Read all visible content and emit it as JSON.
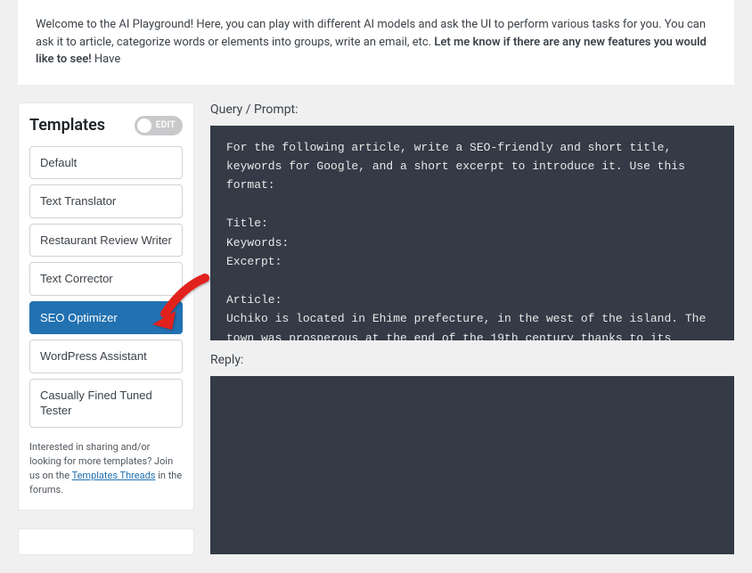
{
  "welcome": {
    "text_before": "Welcome to the AI Playground! Here, you can play with different AI models and ask the UI to perform various tasks for you. You can ask it to article, categorize words or elements into groups, write an email, etc. ",
    "text_bold": "Let me know if there are any new features you would like to see!",
    "text_after": " Have"
  },
  "sidebar": {
    "title": "Templates",
    "edit_label": "EDIT",
    "items": [
      {
        "label": "Default",
        "active": false
      },
      {
        "label": "Text Translator",
        "active": false
      },
      {
        "label": "Restaurant Review Writer",
        "active": false
      },
      {
        "label": "Text Corrector",
        "active": false
      },
      {
        "label": "SEO Optimizer",
        "active": true
      },
      {
        "label": "WordPress Assistant",
        "active": false
      },
      {
        "label": "Casually Fined Tuned Tester",
        "active": false
      }
    ],
    "note_before": "Interested in sharing and/or looking for more templates? Join us on the ",
    "note_link": "Templates Threads",
    "note_after": " in the forums."
  },
  "main": {
    "query_label": "Query / Prompt:",
    "prompt_text": "For the following article, write a SEO-friendly and short title, keywords for Google, and a short excerpt to introduce it. Use this format:\n\nTitle:\nKeywords:\nExcerpt:\n\nArticle:\nUchiko is located in Ehime prefecture, in the west of the island. The town was prosperous at the end of the 19th century thanks to its production of very good quality white wax. This economic boom allowed wealthy local merchants to build beautiful properties, whose heritage is still visible throughout the town.",
    "reply_label": "Reply:"
  }
}
